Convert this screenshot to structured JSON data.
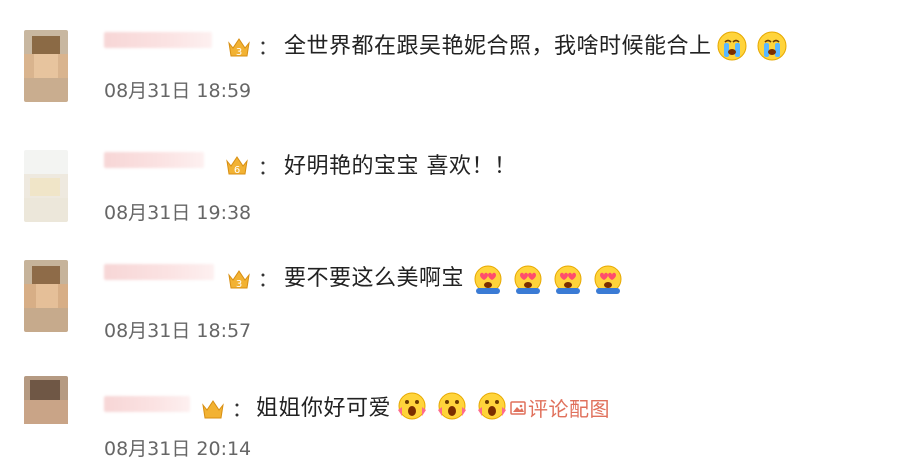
{
  "comments": [
    {
      "text": "全世界都在跟吴艳妮合照，我啥时候能合上",
      "timestamp": "08月31日 18:59",
      "colon": "：",
      "badge_number": "3",
      "emoji": "crying-face"
    },
    {
      "text": "好明艳的宝宝 喜欢！！",
      "timestamp": "08月31日 19:38",
      "colon": "：",
      "badge_number": "6"
    },
    {
      "text": "要不要这么美啊宝",
      "timestamp": "08月31日 18:57",
      "colon": "：",
      "badge_number": "3",
      "emoji": "heart-eyes-face"
    },
    {
      "text": "姐姐你好可爱",
      "timestamp": "08月31日 20:14",
      "colon": "：",
      "emoji": "screaming-face",
      "link_text": "评论配图"
    }
  ],
  "colors": {
    "link": "#e0715c",
    "badge_gold": "#f2b233",
    "text": "#222222",
    "timestamp": "#666666"
  }
}
